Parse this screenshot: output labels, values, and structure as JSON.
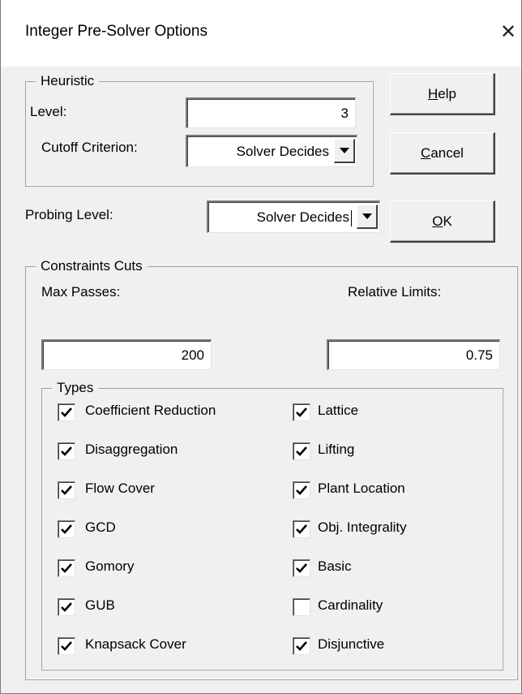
{
  "window": {
    "title": "Integer Pre-Solver Options",
    "close_glyph": "✕"
  },
  "heuristic": {
    "legend": "Heuristic",
    "level_label": "Level:",
    "level_value": "3",
    "cutoff_label": "Cutoff Criterion:",
    "cutoff_value": "Solver Decides"
  },
  "probing": {
    "label": "Probing Level:",
    "value": "Solver Decides"
  },
  "buttons": {
    "help": {
      "mnemonic": "H",
      "rest": "elp"
    },
    "cancel": {
      "mnemonic": "C",
      "rest": "ancel"
    },
    "ok": {
      "mnemonic": "O",
      "rest": "K"
    }
  },
  "constraints": {
    "legend": "Constraints Cuts",
    "max_passes_label": "Max Passes:",
    "max_passes_value": "200",
    "relative_limits_label": "Relative Limits:",
    "relative_limits_value": "0.75"
  },
  "types": {
    "legend": "Types",
    "left": [
      {
        "label": "Coefficient Reduction",
        "checked": true
      },
      {
        "label": "Disaggregation",
        "checked": true
      },
      {
        "label": "Flow Cover",
        "checked": true
      },
      {
        "label": "GCD",
        "checked": true
      },
      {
        "label": "Gomory",
        "checked": true
      },
      {
        "label": "GUB",
        "checked": true
      },
      {
        "label": "Knapsack Cover",
        "checked": true
      }
    ],
    "right": [
      {
        "label": "Lattice",
        "checked": true
      },
      {
        "label": "Lifting",
        "checked": true
      },
      {
        "label": "Plant Location",
        "checked": true
      },
      {
        "label": "Obj. Integrality",
        "checked": true
      },
      {
        "label": "Basic",
        "checked": true
      },
      {
        "label": "Cardinality",
        "checked": false
      },
      {
        "label": "Disjunctive",
        "checked": true
      }
    ]
  }
}
